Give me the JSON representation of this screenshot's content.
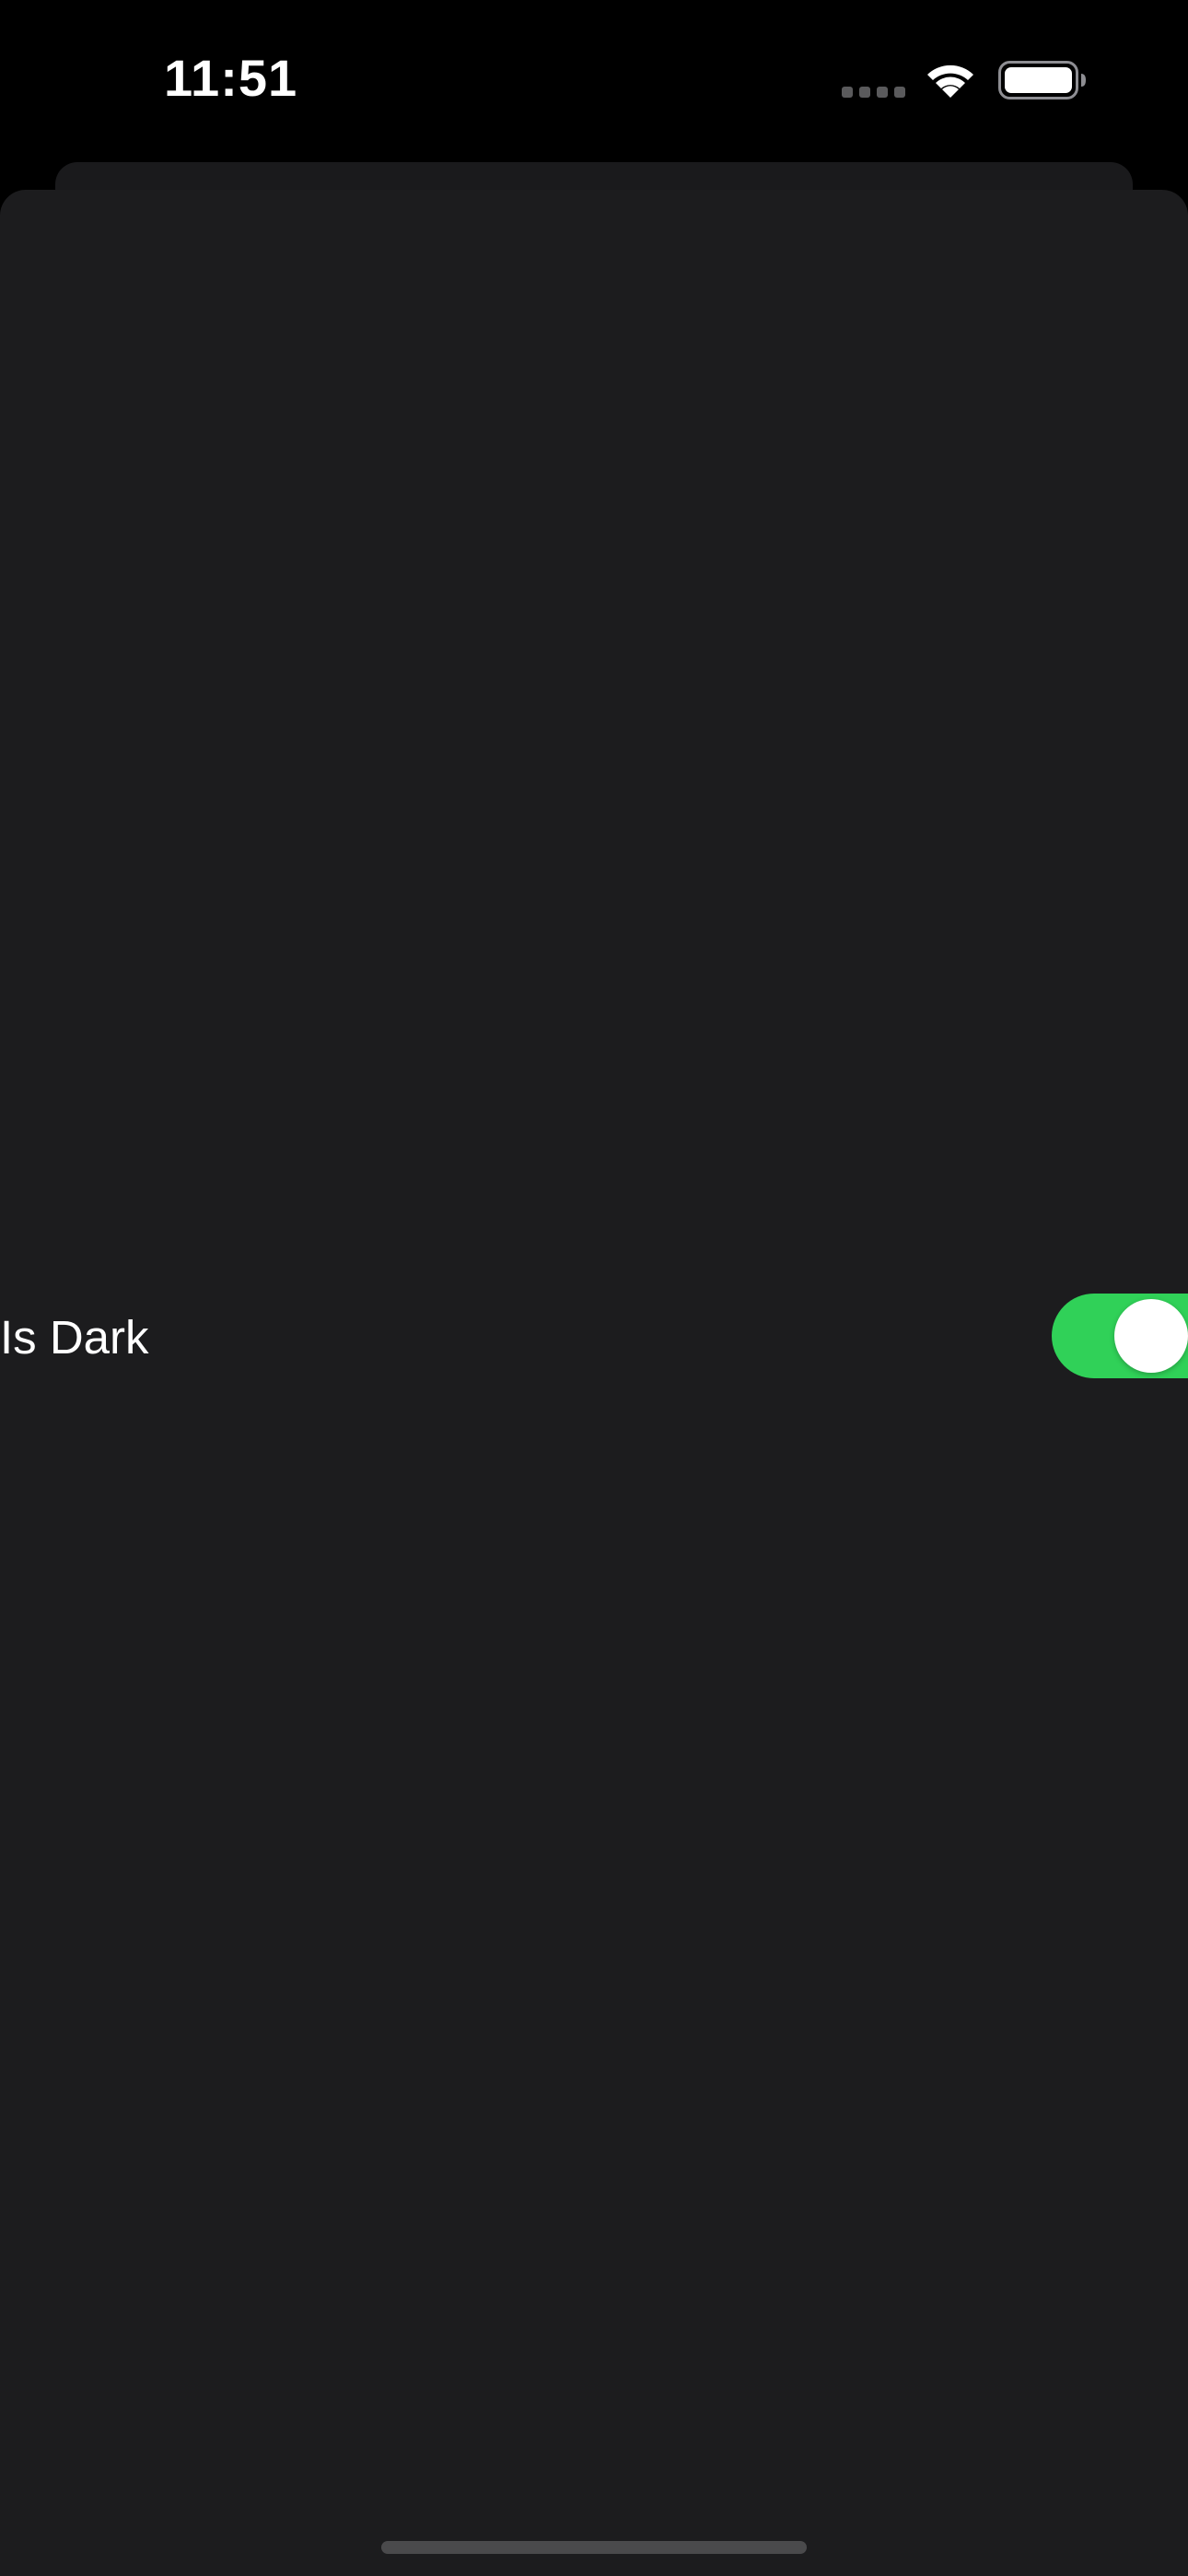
{
  "status_bar": {
    "time": "11:51",
    "icons": [
      "cellular-signal-icon",
      "wifi-icon",
      "battery-icon"
    ]
  },
  "settings": {
    "is_dark": {
      "label": "Is Dark",
      "on": true
    }
  },
  "colors": {
    "background": "#000000",
    "sheet": "#1c1c1e",
    "toggle_on": "#30d158",
    "text": "#ffffff"
  }
}
